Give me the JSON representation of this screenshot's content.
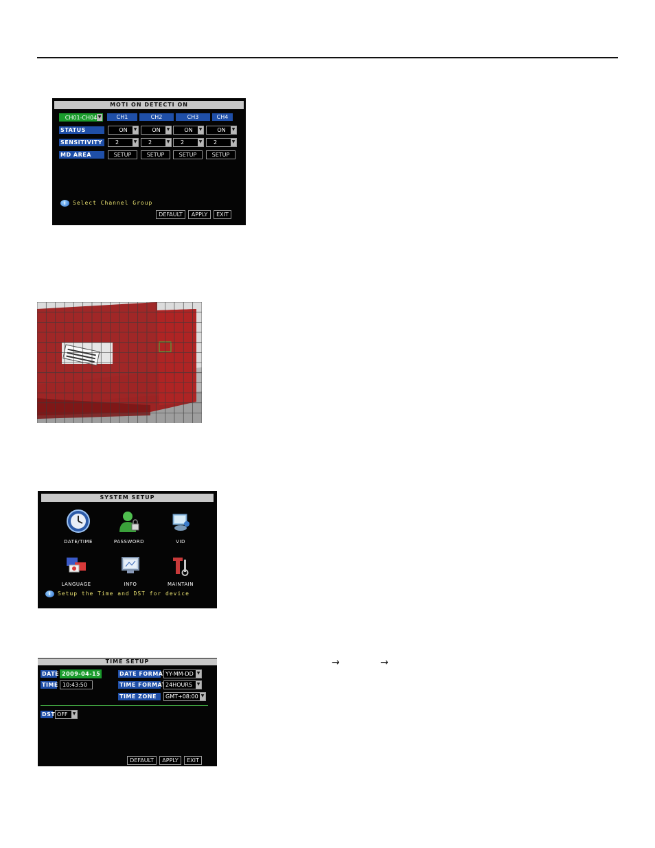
{
  "motion_detection": {
    "title": "MOTI ON  DETECTI ON",
    "group_select": "CH01-CH04",
    "channels": [
      "CH1",
      "CH2",
      "CH3",
      "CH4"
    ],
    "status_label": "STATUS",
    "status_values": [
      "ON",
      "ON",
      "ON",
      "ON"
    ],
    "sensitivity_label": "SENSITIVITY",
    "sensitivity_values": [
      "2",
      "2",
      "2",
      "2"
    ],
    "md_area_label": "MD  AREA",
    "setup_label": "SETUP",
    "hint": "Select  Channel  Group",
    "buttons": {
      "default": "DEFAULT",
      "apply": "APPLY",
      "exit": "EXIT"
    }
  },
  "system_setup": {
    "title": "SYSTEM  SETUP",
    "items": [
      {
        "label": "DATE/TIME",
        "icon": "clock-icon"
      },
      {
        "label": "PASSWORD",
        "icon": "user-lock-icon"
      },
      {
        "label": "VID",
        "icon": "video-icon"
      },
      {
        "label": "LANGUAGE",
        "icon": "flags-icon"
      },
      {
        "label": "INFO",
        "icon": "monitor-icon"
      },
      {
        "label": "MAINTAIN",
        "icon": "tools-icon"
      }
    ],
    "hint": "Setup  the  Time  and  DST  for  device"
  },
  "time_setup": {
    "title": "TIME  SETUP",
    "date_label": "DATE",
    "date_value": "2009-04-15",
    "time_label": "TIME",
    "time_value": "10:43:50",
    "date_format_label": "DATE  FORMAT",
    "date_format_value": "YY-MM-DD",
    "time_format_label": "TIME  FORMAT",
    "time_format_value": "24HOURS",
    "time_zone_label": "TIME    ZONE",
    "time_zone_value": "GMT+08:00",
    "dst_label": "DST",
    "dst_value": "OFF",
    "buttons": {
      "default": "DEFAULT",
      "apply": "APPLY",
      "exit": "EXIT"
    }
  },
  "arrows": [
    "→",
    "→"
  ]
}
